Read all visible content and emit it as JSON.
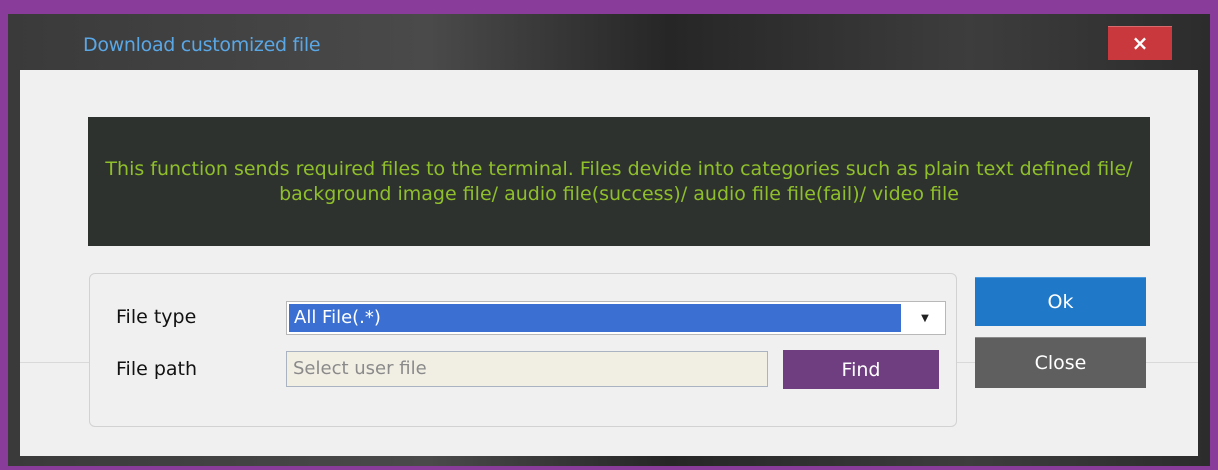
{
  "window": {
    "title": "Download customized file",
    "close_glyph": "×",
    "accent_title_color": "#5aa7e6",
    "close_color": "#c9383c"
  },
  "description": {
    "text": "This function sends required files to the terminal. Files devide into categories such as plain text defined file/ background image file/ audio file(success)/ audio file file(fail)/ video file",
    "text_color": "#8fbf2a"
  },
  "form": {
    "file_type_label": "File type",
    "file_type_selected": "All File(.*)",
    "file_type_arrow_icon": "dropdown-arrow-icon",
    "file_path_label": "File path",
    "file_path_placeholder": "Select user file",
    "find_label": "Find"
  },
  "actions": {
    "ok_label": "Ok",
    "close_label": "Close",
    "ok_color": "#1f78c8",
    "find_color": "#6e3e80"
  }
}
